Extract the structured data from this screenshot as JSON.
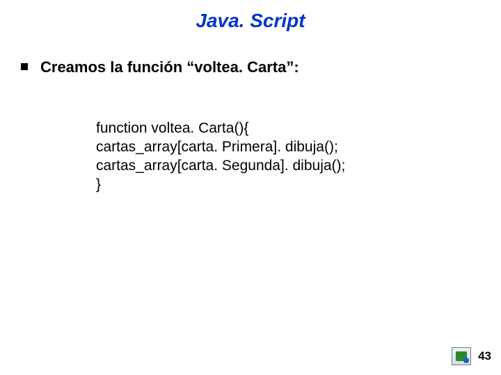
{
  "title": "Java. Script",
  "bullet": {
    "text": "Creamos la función “voltea. Carta”:"
  },
  "code": {
    "lines": [
      "function voltea. Carta(){",
      "cartas_array[carta. Primera]. dibuja();",
      "cartas_array[carta. Segunda]. dibuja();",
      "}"
    ]
  },
  "footer": {
    "icon_name": "presentation-logo",
    "page_number": "43"
  }
}
